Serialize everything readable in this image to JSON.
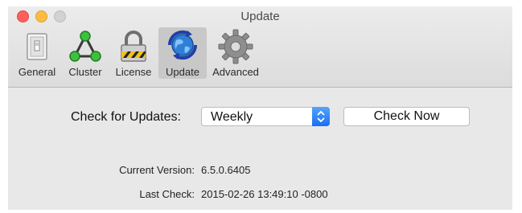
{
  "window": {
    "title": "Update",
    "traffic_lights": [
      "close",
      "minimize",
      "zoom"
    ]
  },
  "toolbar": {
    "tabs": [
      {
        "label": "General",
        "icon": "switch-icon",
        "selected": false
      },
      {
        "label": "Cluster",
        "icon": "network-nodes-icon",
        "selected": false
      },
      {
        "label": "License",
        "icon": "padlock-icon",
        "selected": false
      },
      {
        "label": "Update",
        "icon": "globe-refresh-icon",
        "selected": true
      },
      {
        "label": "Advanced",
        "icon": "gear-icon",
        "selected": false
      }
    ]
  },
  "update": {
    "check_label": "Check for Updates:",
    "frequency_value": "Weekly",
    "check_now_label": "Check Now",
    "current_version_label": "Current Version:",
    "current_version_value": "6.5.0.6405",
    "last_check_label": "Last Check:",
    "last_check_value": "2015-02-26 13:49:10 -0800"
  },
  "colors": {
    "accent_blue": "#1a6ff3",
    "close": "#fc605c",
    "minimize": "#fdbc40",
    "zoom_disabled": "#d2d2d2"
  }
}
